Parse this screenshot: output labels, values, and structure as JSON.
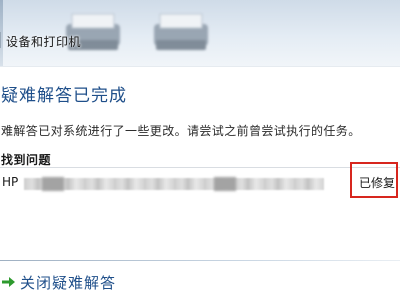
{
  "header": {
    "breadcrumb": "设备和打印机"
  },
  "main": {
    "title": "疑难解答已完成",
    "description": "难解答已对系统进行了一些更改。请尝试之前曾尝试执行的任务。",
    "section_title": "找到问题",
    "problems": [
      {
        "device": "HP",
        "status": "已修复"
      }
    ],
    "close_link": "关闭疑难解答"
  },
  "colors": {
    "title": "#1f4f8a",
    "highlight_box": "#d7261e",
    "link": "#1f4f8a",
    "arrow": "#2e9a2e"
  }
}
